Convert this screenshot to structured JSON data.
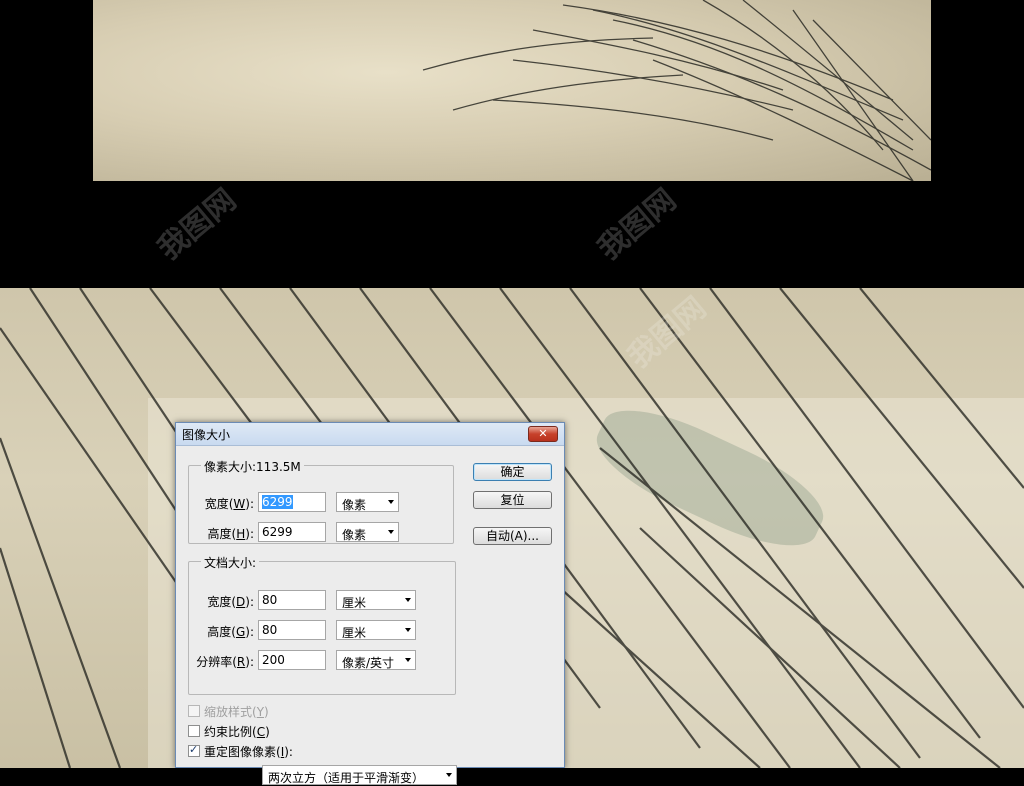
{
  "dialog": {
    "title": "图像大小",
    "close_glyph": "✕",
    "pixel_dimensions": {
      "legend": "像素大小:113.5M",
      "width": {
        "label": "宽度",
        "key": "W",
        "value": "6299",
        "unit": "像素"
      },
      "height": {
        "label": "高度",
        "key": "H",
        "value": "6299",
        "unit": "像素"
      }
    },
    "document_size": {
      "legend": "文档大小:",
      "width": {
        "label": "宽度",
        "key": "D",
        "value": "80",
        "unit": "厘米"
      },
      "height": {
        "label": "高度",
        "key": "G",
        "value": "80",
        "unit": "厘米"
      },
      "resolution": {
        "label": "分辨率",
        "key": "R",
        "value": "200",
        "unit": "像素/英寸"
      }
    },
    "buttons": {
      "ok": "确定",
      "reset": "复位",
      "auto": "自动(A)..."
    },
    "checkboxes": {
      "scale_styles": {
        "label": "缩放样式",
        "key": "Y",
        "checked": false,
        "enabled": false
      },
      "constrain": {
        "label": "约束比例",
        "key": "C",
        "checked": false,
        "enabled": true
      },
      "resample": {
        "label": "重定图像像素",
        "key": "I",
        "checked": true,
        "enabled": true
      }
    },
    "resample_method": "两次立方（适用于平滑渐变）"
  },
  "watermark_text": "我图网",
  "colors": {
    "background": "#000000",
    "dialog_bg": "#ececec",
    "title_gradient_top": "#dfe9f5",
    "close_red": "#c7412b",
    "selection_blue": "#3399ff"
  }
}
